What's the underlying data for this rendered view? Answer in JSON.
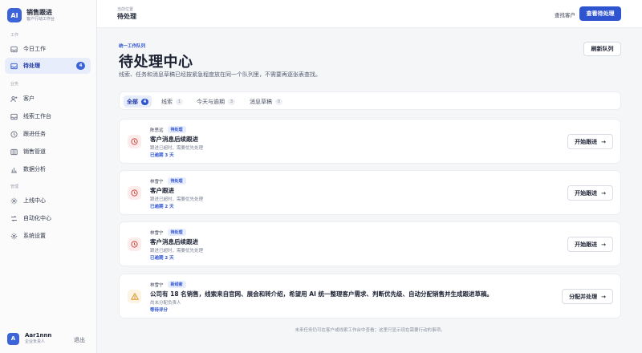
{
  "brand": {
    "logo": "AI",
    "name": "销售跟进",
    "subtitle": "客户行动工作台"
  },
  "sidebar": {
    "sections": [
      {
        "label": "工作",
        "items": [
          {
            "label": "今日工作",
            "icon": "inbox-icon"
          },
          {
            "label": "待处理",
            "icon": "tray-icon",
            "badge": "4",
            "active": true
          }
        ]
      },
      {
        "label": "业务",
        "items": [
          {
            "label": "客户",
            "icon": "user-plus-icon"
          },
          {
            "label": "线索工作台",
            "icon": "inbox-icon"
          },
          {
            "label": "跟进任务",
            "icon": "clock-icon"
          },
          {
            "label": "销售管道",
            "icon": "funnel-icon"
          },
          {
            "label": "数据分析",
            "icon": "bar-chart-icon"
          }
        ]
      },
      {
        "label": "管理",
        "items": [
          {
            "label": "上线中心",
            "icon": "gear-icon"
          },
          {
            "label": "自动化中心",
            "icon": "shuffle-icon"
          },
          {
            "label": "系统设置",
            "icon": "gear-icon"
          }
        ]
      }
    ]
  },
  "user": {
    "avatar": "A",
    "name": "Aar1nnn",
    "role": "企业负责人",
    "logout": "退出"
  },
  "topbar": {
    "crumb": "当前位置",
    "title": "待处理",
    "find_link": "查找客户",
    "primary_button": "查看待处理"
  },
  "header": {
    "eyebrow": "统一工作队列",
    "title": "待处理中心",
    "description": "线索、任务和消息草稿已经按紧急程度放在同一个队列里，不需要再逐张表查找。",
    "refresh_button": "刷新队列"
  },
  "tabs": [
    {
      "label": "全部",
      "count": "4",
      "active": true
    },
    {
      "label": "线索",
      "count": "1"
    },
    {
      "label": "今天与逾期",
      "count": "3"
    },
    {
      "label": "消息草稿",
      "count": "0"
    }
  ],
  "cards": [
    {
      "person": "陈思远",
      "tag": "待处理",
      "title": "客户消息后续跟进",
      "subtitle": "跟进已超时，需要优先处理",
      "status": "已逾期 3 天",
      "button": "开始跟进",
      "icon": "clock-icon",
      "tone": "red"
    },
    {
      "person": "林雪宁",
      "tag": "待处理",
      "title": "客户跟进",
      "subtitle": "跟进已超时，需要优先处理",
      "status": "已逾期 2 天",
      "button": "开始跟进",
      "icon": "clock-icon",
      "tone": "red"
    },
    {
      "person": "林雪宁",
      "tag": "待处理",
      "title": "客户消息后续跟进",
      "subtitle": "跟进已超时，需要优先处理",
      "status": "已逾期 2 天",
      "button": "开始跟进",
      "icon": "clock-icon",
      "tone": "red"
    },
    {
      "person": "林雪宁",
      "tag": "新线索",
      "title": "公司有 18 名销售，线索来自官网、展会和转介绍，希望用 AI 统一整理客户需求、判断优先级、自动分配销售并生成跟进草稿。",
      "subtitle": "尚未分配负责人",
      "status": "等待评分",
      "button": "分配并处理",
      "icon": "warning-icon",
      "tone": "amber"
    }
  ],
  "footer_note": "未来任务仍可在客户或线索工作台中查看；这里只显示现在需要行动的事项。"
}
